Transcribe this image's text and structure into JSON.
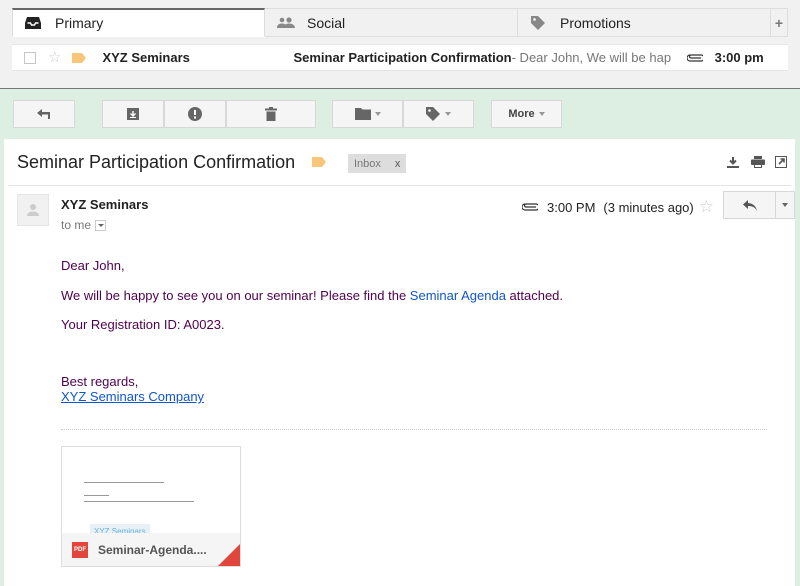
{
  "tabs": [
    {
      "label": "Primary",
      "icon": "inbox-icon",
      "active": true
    },
    {
      "label": "Social",
      "icon": "people-icon",
      "active": false
    },
    {
      "label": "Promotions",
      "icon": "tag-icon",
      "active": false
    }
  ],
  "tab_add_label": "+",
  "email_row": {
    "sender": "XYZ Seminars",
    "subject": "Seminar Participation Confirmation",
    "snippet": " - Dear John, We will be hap",
    "time": "3:00 pm",
    "has_attachment": true,
    "starred": false,
    "label_color": "#f8c67a"
  },
  "toolbar": {
    "more_label": "More"
  },
  "message": {
    "subject": "Seminar Participation Confirmation",
    "label_chip": "Inbox",
    "label_chip_close": "x",
    "from": "XYZ Seminars",
    "to": "to me",
    "time": "3:00 PM",
    "relative_time": "(3 minutes ago)",
    "greeting": "Dear John,",
    "line1_before": "We will be happy to see you on our seminar! Please find the ",
    "line1_link": "Seminar Agenda",
    "line1_after": " attached.",
    "line2": "Your Registration ID: A0023.",
    "closing": "Best regards,",
    "signature_link": "XYZ Seminars Company"
  },
  "attachment": {
    "type_badge": "PDF",
    "filename": "Seminar-Agenda....",
    "preview_watermark": "XYZ Seminars"
  },
  "colors": {
    "link": "#1155cc",
    "body_text": "#500050",
    "background_green": "#dcefe2",
    "label_orange": "#f8c67a",
    "pdf_red": "#e0463b"
  }
}
